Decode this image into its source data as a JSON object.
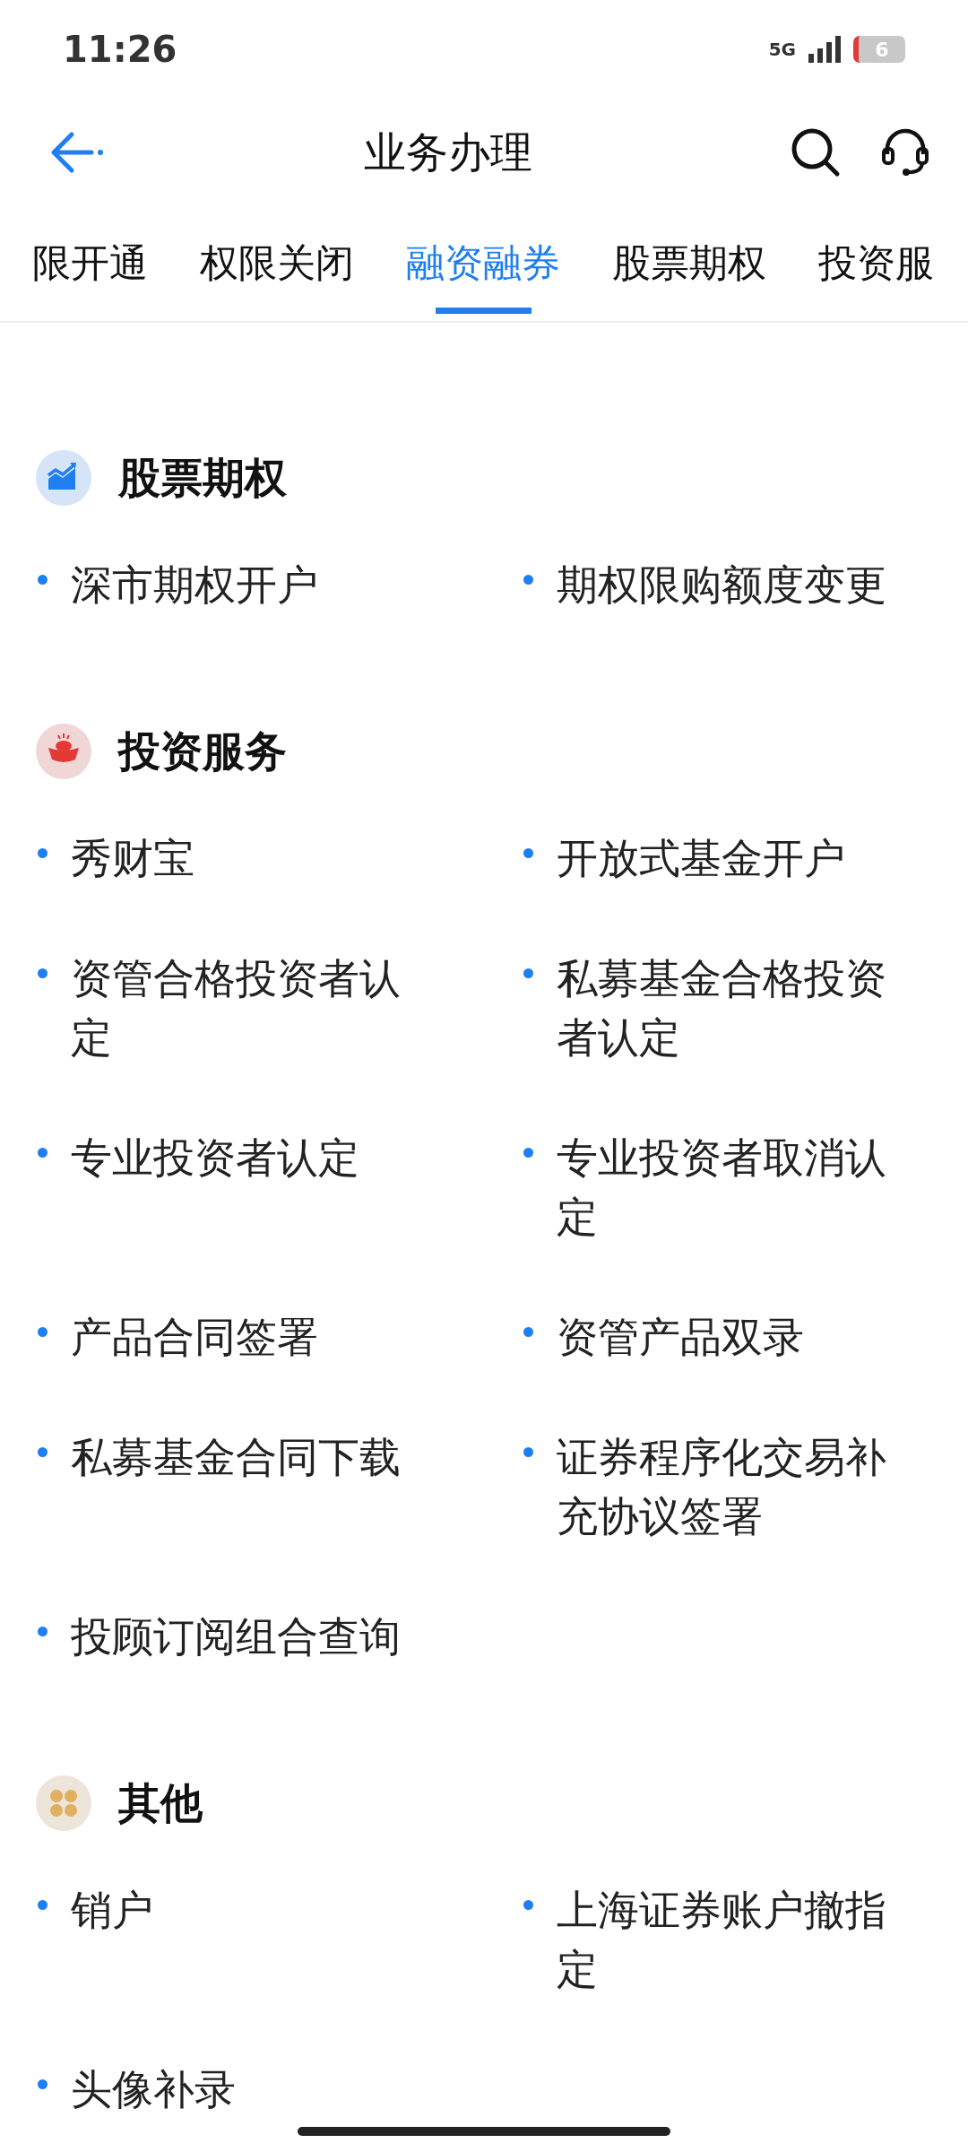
{
  "status_bar": {
    "time": "11:26",
    "network": "5G",
    "battery": "6"
  },
  "header": {
    "title": "业务办理"
  },
  "tabs": [
    {
      "label": "限开通",
      "selected": false
    },
    {
      "label": "权限关闭",
      "selected": false
    },
    {
      "label": "融资融券",
      "selected": true
    },
    {
      "label": "股票期权",
      "selected": false
    },
    {
      "label": "投资服",
      "selected": false
    }
  ],
  "sections": [
    {
      "title": "股票期权",
      "kind": "chart",
      "items": [
        "深市期权开户",
        "期权限购额度变更"
      ]
    },
    {
      "title": "投资服务",
      "kind": "ingot",
      "items": [
        "秀财宝",
        "开放式基金开户",
        "资管合格投资者认定",
        "私募基金合格投资者认定",
        "专业投资者认定",
        "专业投资者取消认定",
        "产品合同签署",
        "资管产品双录",
        "私募基金合同下载",
        "证券程序化交易补充协议签署",
        "投顾订阅组合查询"
      ]
    },
    {
      "title": "其他",
      "kind": "clover",
      "items": [
        "销户",
        "上海证券账户撤指定",
        "头像补录"
      ]
    }
  ]
}
